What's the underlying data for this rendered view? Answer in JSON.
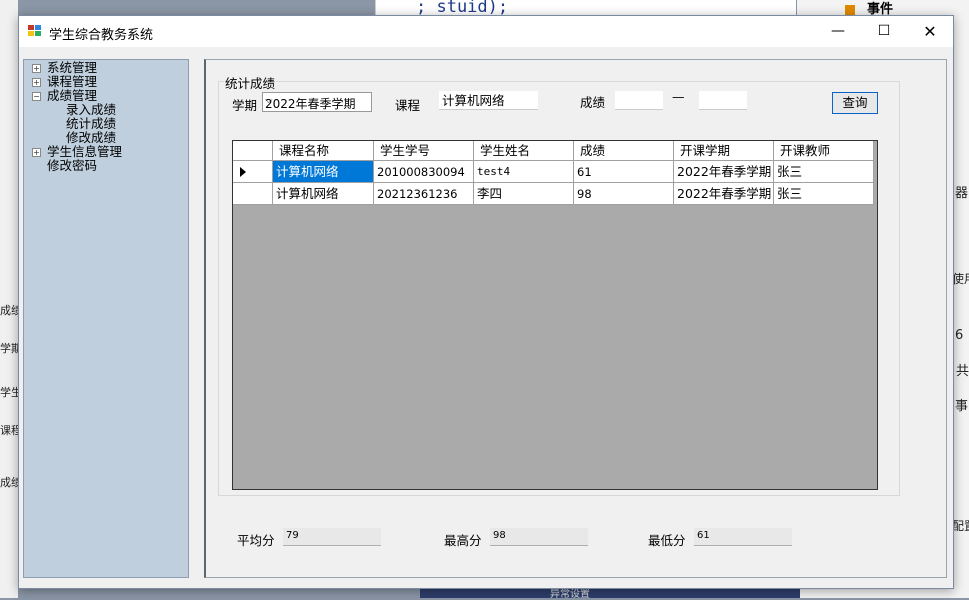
{
  "background": {
    "code_text": "; stuid);",
    "right_panel_title": "事件",
    "left_fragments": [
      "成绩",
      "学期",
      "学生",
      "课程",
      "成绩"
    ],
    "right_fragments": [
      "器",
      "使用",
      "6",
      "共",
      "事",
      "配置"
    ],
    "bottom_fragment": "异常设置"
  },
  "window": {
    "title": "学生综合教务系统",
    "minimize": "—",
    "maximize": "☐",
    "close": "✕"
  },
  "tree": {
    "nodes": [
      {
        "label": "系统管理",
        "expander": "+"
      },
      {
        "label": "课程管理",
        "expander": "+"
      },
      {
        "label": "成绩管理",
        "expander": "−"
      },
      {
        "label": "录入成绩"
      },
      {
        "label": "统计成绩"
      },
      {
        "label": "修改成绩"
      },
      {
        "label": "学生信息管理",
        "expander": "+"
      },
      {
        "label": "修改密码"
      }
    ]
  },
  "filter": {
    "group_title": "统计成绩",
    "term_label": "学期",
    "term_value": "2022年春季学期",
    "course_label": "课程",
    "course_value": "计算机网络",
    "score_label": "成绩",
    "score_min": "",
    "score_dash": "—",
    "score_max": "",
    "query_button": "查询"
  },
  "table": {
    "columns": [
      "课程名称",
      "学生学号",
      "学生姓名",
      "成绩",
      "开课学期",
      "开课教师"
    ],
    "rows": [
      [
        "计算机网络",
        "201000830094",
        "test4",
        "61",
        "2022年春季学期",
        "张三"
      ],
      [
        "计算机网络",
        "20212361236",
        "李四",
        "98",
        "2022年春季学期",
        "张三"
      ]
    ],
    "selected_row": 0
  },
  "stats": {
    "avg_label": "平均分",
    "avg_value": "79",
    "max_label": "最高分",
    "max_value": "98",
    "min_label": "最低分",
    "min_value": "61"
  },
  "colors": {
    "selection": "#0078d7",
    "tree_bg": "#bfcfdd",
    "grid_bg": "#aaaaaa"
  }
}
